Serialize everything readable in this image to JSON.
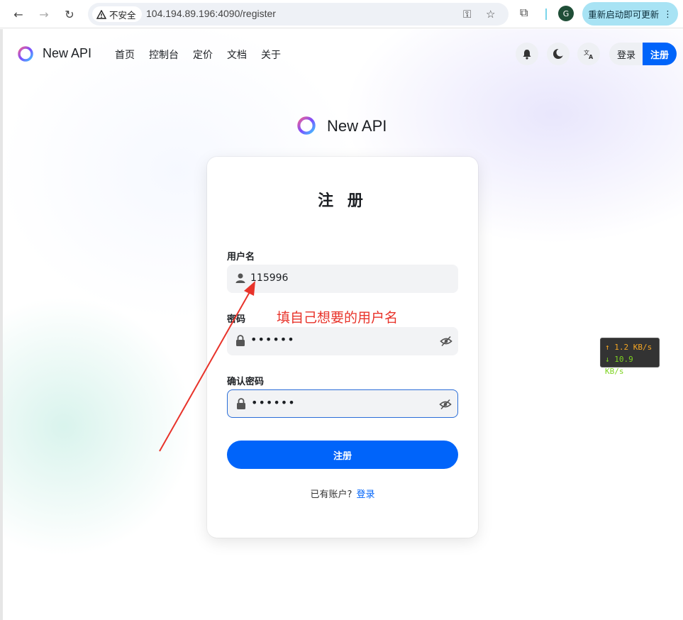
{
  "browser": {
    "back_icon": "←",
    "forward_icon": "→",
    "reload_icon": "↻",
    "security_label": "不安全",
    "url": "104.194.89.196:4090/register",
    "key_icon": "⚿",
    "star_icon": "☆",
    "extension_icon": "⧉",
    "profile_initial": "G",
    "update_label": "重新启动即可更新",
    "update_menu_icon": "⋮"
  },
  "header": {
    "site_name": "New API",
    "nav": [
      "首页",
      "控制台",
      "定价",
      "文档",
      "关于"
    ],
    "login_label": "登录",
    "register_label": "注册"
  },
  "brand": {
    "name": "New API"
  },
  "form": {
    "title": "注 册",
    "username_label": "用户名",
    "username_value": "115996",
    "password_label": "密码",
    "password_value": "••••••",
    "confirm_label": "确认密码",
    "confirm_value": "••••••",
    "submit_label": "注册",
    "footer_text": "已有账户?",
    "footer_link": "登录"
  },
  "annotation": {
    "text": "填自己想要的用户名",
    "color": "#e8332a"
  },
  "speed": {
    "up": "↑ 1.2 KB/s",
    "down": "↓ 10.9 KB/s"
  },
  "colors": {
    "primary": "#0064fa",
    "accent_update": "#a8e3f4"
  }
}
